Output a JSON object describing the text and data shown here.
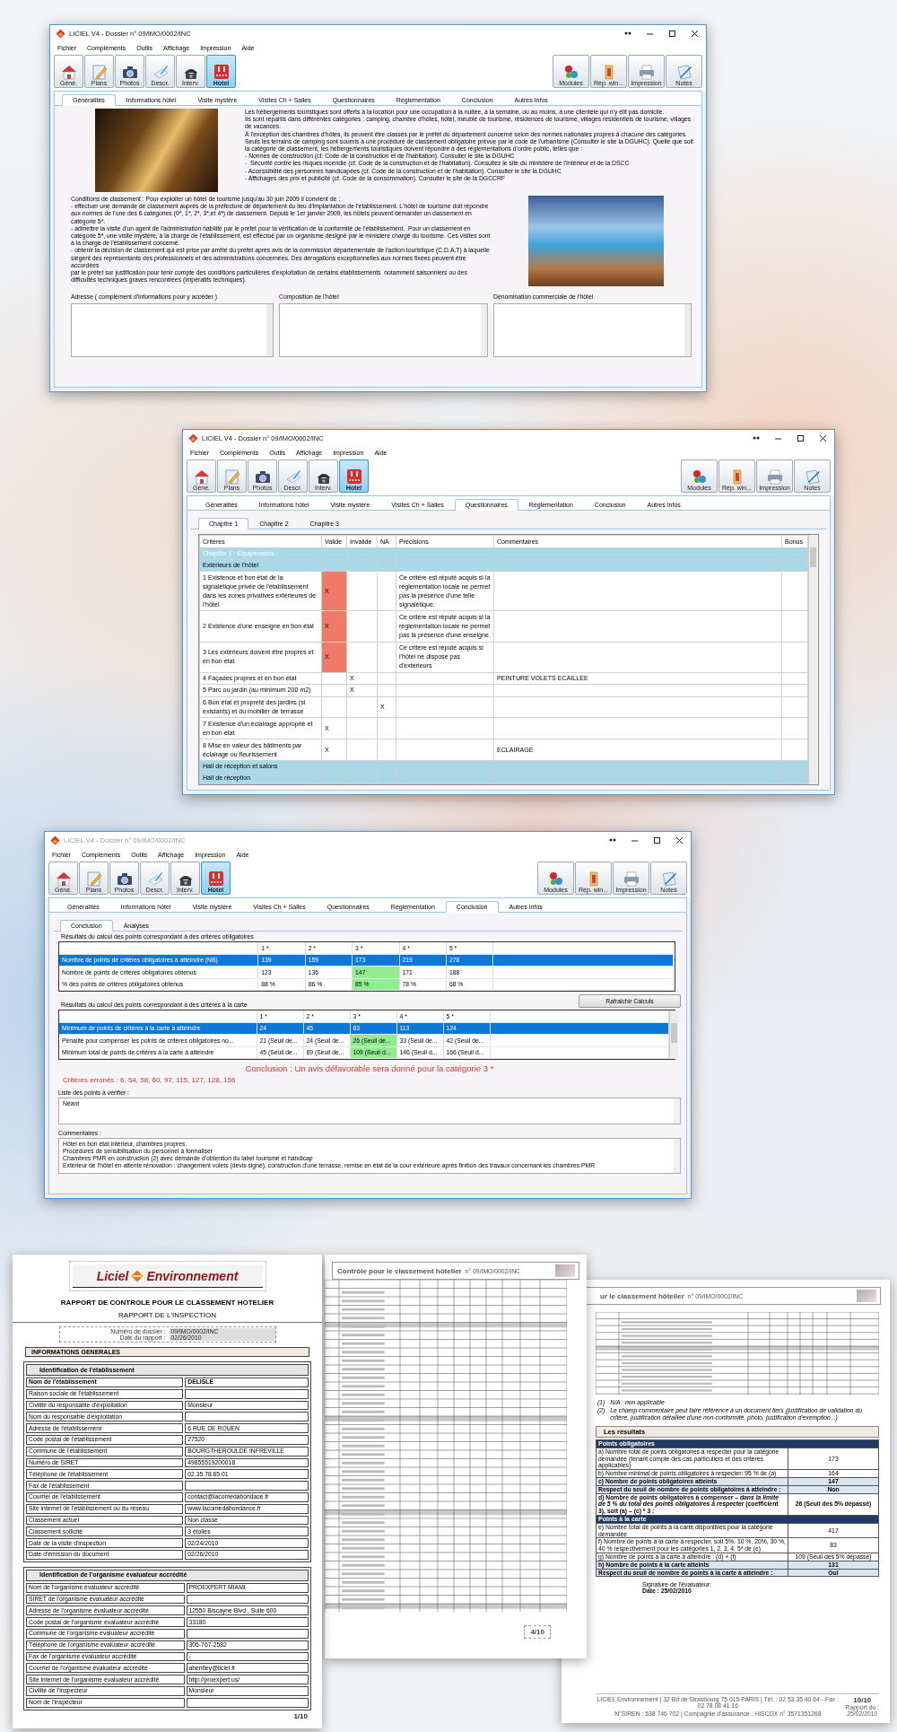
{
  "windows": [
    {
      "title": "LICIEL V4 - Dossier n° 09/IMO/0002/INC",
      "active": true,
      "menu": [
        "Fichier",
        "Compléments",
        "Outils",
        "Affichage",
        "Impression",
        "Aide"
      ],
      "toolbar_left": [
        {
          "label": "Géné.",
          "selected": false
        },
        {
          "label": "Plans",
          "selected": false
        },
        {
          "label": "Photos",
          "selected": false
        },
        {
          "label": "Descr.",
          "selected": false
        },
        {
          "label": "Interv.",
          "selected": false
        },
        {
          "label": "Hotel",
          "selected": true
        }
      ],
      "toolbar_right": [
        "Modules",
        "Rép. win...",
        "Impression",
        "Notes"
      ],
      "tabs": [
        {
          "label": "Généralités",
          "selected": true
        },
        {
          "label": "Informations hôtel",
          "selected": false
        },
        {
          "label": "Visite mystère",
          "selected": false
        },
        {
          "label": "Visites Ch + Salles",
          "selected": false
        },
        {
          "label": "Questionnaires",
          "selected": false
        },
        {
          "label": "Réglementation",
          "selected": false
        },
        {
          "label": "Conclusion",
          "selected": false
        },
        {
          "label": "Autres Infos",
          "selected": false
        }
      ],
      "content": {
        "kind": "generalites",
        "intro": "Les hébergements touristiques sont offerts à la location pour une occupation à la nuitée, à la semaine, ou au moins, à une clientèle qui n'y élit pas domicile.\nIls sont répartis dans différentes catégories : camping, chambre d'hôtes, hôtel, meublé de tourisme, résidences de tourisme, villages résidentiels de tourisme, villages de vacances.\nÀ l'exception des chambres d'hôtes, ils peuvent être classés par le préfet du département concerné selon des normes nationales propres à chacune des catégories. Seuls les terrains de camping sont soumis à une procédure de classement obligatoire prévue par le code de l'urbanisme (Consulter le site la DGUHC). Quelle que soit la catégorie de classement, les hébergements touristiques doivent répondre à des réglementations d'ordre public, telles que :\n- Normes de construction (cf. Code de la construction et de l'habitation). Consulter le site la DGUHC\n-  Sécurité contre les risques incendie (cf. Code de la construction et de l'habitation). Consultez le site du ministère de l'Intérieur et de la DSCC\n- Accessibilité des personnes handicapées (cf. Code de la construction et de l'habitation). Consulter le site la DGUHC\n- Affichages des prix et publicité (cf. Code de la consommation). Consulter le site de la DGCCRF",
        "conditions": "Conditions de classement : Pour exploiter un hôtel de tourisme jusqu'au 30 juin 2009 il convient de :\n- effectuer une demande de classement auprès de la préfecture de département du lieu d'implantation de l'établissement. L'hôtel de tourisme doit répondre aux normes de l'une des 6 catégories (0*, 1*, 2*, 3*,et 4*) de classement. Depuis le 1er janvier 2009, les hôtels peuvent demander un classement en catégorie 5*.\n- admettre la visite d'un agent de l'administration habilité par le préfet pour la vérification de la conformité de l'établissement.  Pour un classement en catégorie 5*, une visite mystère, à la charge de l'établissement, est effectué par un organisme désigné par le ministère chargé du tourisme. Ces visites sont à la charge de l'établissement concerné.\n- obtenir la décision de classement qui est prise par arrêté du préfet après avis de la commission départementale de l'action touristique (C.D.A.T) à laquelle siègent des représentants des professionnels et des administrations concernées. Des dérogations exceptionnelles aux normes fixées peuvent être accordées\npar le préfet sur justification pour tenir compte des conditions particulières d'exploitation de certains établissements  notamment saisonniers ou des difficultés techniques graves rencontrées (impératifs techniques).",
        "fields": [
          {
            "label": "Adresse ( complément d'informations pour y accéder )"
          },
          {
            "label": "Composition de l'hôtel"
          },
          {
            "label": "Dénomination commerciale de l'hôtel"
          }
        ]
      }
    },
    {
      "title": "LICIEL V4 - Dossier n° 09/IMO/0002/INC",
      "active": true,
      "menu": [
        "Fichier",
        "Compléments",
        "Outils",
        "Affichage",
        "Impression",
        "Aide"
      ],
      "toolbar_left": [
        {
          "label": "Géné.",
          "selected": false
        },
        {
          "label": "Plans",
          "selected": false
        },
        {
          "label": "Photos",
          "selected": false
        },
        {
          "label": "Descr.",
          "selected": false
        },
        {
          "label": "Interv.",
          "selected": false
        },
        {
          "label": "Hotel",
          "selected": true
        }
      ],
      "toolbar_right": [
        "Modules",
        "Rép. win...",
        "Impression",
        "Notes"
      ],
      "tabs": [
        {
          "label": "Généralités",
          "selected": false
        },
        {
          "label": "Informations hôtel",
          "selected": false
        },
        {
          "label": "Visite mystère",
          "selected": false
        },
        {
          "label": "Visites Ch + Salles",
          "selected": false
        },
        {
          "label": "Questionnaires",
          "selected": true
        },
        {
          "label": "Réglementation",
          "selected": false
        },
        {
          "label": "Conclusion",
          "selected": false
        },
        {
          "label": "Autres Infos",
          "selected": false
        }
      ],
      "content": {
        "kind": "questionnaires",
        "subtabs": [
          {
            "label": "Chapitre 1",
            "selected": true
          },
          {
            "label": "Chapitre 2",
            "selected": false
          },
          {
            "label": "Chapitre 3",
            "selected": false
          }
        ],
        "columns": [
          "Critères",
          "Valide",
          "Invalide",
          "NA",
          "Précisions",
          "Commentaires",
          "Bonus"
        ],
        "rows": [
          {
            "kind": "chapter",
            "label": "Chapitre 1 : Equipements",
            "selected": true
          },
          {
            "kind": "section",
            "label": "Extérieurs de l'hôtel",
            "selected": false
          },
          {
            "kind": "item",
            "selected": false,
            "flagged": true,
            "criterion": "1 Existence et bon état de la signalétique privée de l'établissement dans les zones privatives extérieures de l'hôtel",
            "valide": "X",
            "precisions": "Ce critère est réputé acquis si la réglementation locale ne permet pas la présence d'une telle signalétique."
          },
          {
            "kind": "item",
            "selected": false,
            "flagged": true,
            "criterion": "2 Existence d'une enseigne en bon état",
            "valide": "X",
            "precisions": "Ce critère est réputé acquis si la réglementation locale ne permet pas la présence d'une enseigne."
          },
          {
            "kind": "item",
            "selected": false,
            "flagged": true,
            "criterion": "3 Les extérieurs doivent être propres et en bon état",
            "valide": "X",
            "precisions": "Ce critère est réputé acquis si l'hôtel ne dispose pas d'extérieurs"
          },
          {
            "kind": "item",
            "selected": false,
            "flagged": false,
            "criterion": "4 Façades propres et en bon état",
            "invalide": "X",
            "commentaires": "PEINTURE VOLETS ECAILLEE"
          },
          {
            "kind": "item",
            "selected": false,
            "flagged": false,
            "criterion": "5 Parc ou jardin (au minimum 200 m2)",
            "invalide": "X"
          },
          {
            "kind": "item",
            "selected": false,
            "flagged": false,
            "criterion": "6 Bon état et propreté des jardins (si existants) et du mobilier de terrasse",
            "na": "X"
          },
          {
            "kind": "item",
            "selected": false,
            "flagged": false,
            "criterion": "7 Existence d'un éclairage approprié et en bon état",
            "valide": "X"
          },
          {
            "kind": "item",
            "selected": false,
            "flagged": false,
            "criterion": "8 Mise en valeur des bâtiments par éclairage ou fleurissement",
            "valide": "X",
            "commentaires": "ECLAIRAGE"
          },
          {
            "kind": "section",
            "label": "Hall de réception et salons",
            "selected": false
          },
          {
            "kind": "section",
            "label": "Hall de réception",
            "selected": false
          }
        ]
      }
    },
    {
      "title": "LICIEL V4 - Dossier n° 09/IMO/0002/INC",
      "active": false,
      "menu": [
        "Fichier",
        "Compléments",
        "Outils",
        "Affichage",
        "Impression",
        "Aide"
      ],
      "toolbar_left": [
        {
          "label": "Géné.",
          "selected": false
        },
        {
          "label": "Plans",
          "selected": false
        },
        {
          "label": "Photos",
          "selected": false
        },
        {
          "label": "Descr.",
          "selected": false
        },
        {
          "label": "Interv.",
          "selected": false
        },
        {
          "label": "Hotel",
          "selected": true
        }
      ],
      "toolbar_right": [
        "Modules",
        "Rép. win...",
        "Impression",
        "Notes"
      ],
      "tabs": [
        {
          "label": "Généralités",
          "selected": false
        },
        {
          "label": "Informations hôtel",
          "selected": false
        },
        {
          "label": "Visite mystère",
          "selected": false
        },
        {
          "label": "Visites Ch + Salles",
          "selected": false
        },
        {
          "label": "Questionnaires",
          "selected": false
        },
        {
          "label": "Réglementation",
          "selected": false
        },
        {
          "label": "Conclusion",
          "selected": true
        },
        {
          "label": "Autres Infos",
          "selected": false
        }
      ],
      "content": {
        "kind": "conclusion",
        "subtabs": [
          {
            "label": "Conclusion",
            "selected": true
          },
          {
            "label": "Analyses",
            "selected": false
          }
        ],
        "tables": [
          {
            "caption": "Résultats du calcul des points correspondant à des critères obligatoires",
            "columns": [
              {
                "label": "1 *",
                "highlighted": false
              },
              {
                "label": "2 *",
                "highlighted": false
              },
              {
                "label": "3 *",
                "highlighted": true
              },
              {
                "label": "4 *",
                "highlighted": false
              },
              {
                "label": "5 *",
                "highlighted": false
              }
            ],
            "rows": [
              {
                "label": "Nombre de points de critères obligatoires à atteindre (NB)",
                "values": [
                  "139",
                  "159",
                  "173",
                  "219",
                  "278"
                ],
                "selected": true
              },
              {
                "label": "Nombre de points de critères obligatoires obtenus",
                "values": [
                  "123",
                  "136",
                  "147",
                  "171",
                  "188"
                ],
                "selected": false
              },
              {
                "label": "% des points de critères obligatoires obtenus",
                "values": [
                  "88 %",
                  "86 %",
                  "85 %",
                  "78 %",
                  "68 %"
                ],
                "selected": false
              }
            ]
          },
          {
            "caption": "Résultats du calcul des points correspondant à des critères à la carte",
            "button": "Rafraichir Calculs",
            "columns": [
              {
                "label": "1 *",
                "highlighted": false
              },
              {
                "label": "2 *",
                "highlighted": false
              },
              {
                "label": "3 *",
                "highlighted": true
              },
              {
                "label": "4 *",
                "highlighted": false
              },
              {
                "label": "5 *",
                "highlighted": false
              }
            ],
            "rows": [
              {
                "label": "Minimum de points de critères à la carte à atteindre",
                "values": [
                  "24",
                  "45",
                  "83",
                  "113",
                  "124"
                ],
                "selected": true
              },
              {
                "label": "Pénalité pour compenser les points de critères obligatoires no...",
                "values": [
                  "21 (Seuil de...",
                  "24 (Seuil de...",
                  "26 (Seuil de...",
                  "33 (Seuil de...",
                  "42 (Seuil de..."
                ],
                "selected": false
              },
              {
                "label": "Minimum total de points de critères à la carte à atteindre",
                "values": [
                  "45 (Seuil de...",
                  "69 (Seuil de...",
                  "109 (Seuil d...",
                  "146 (Seuil d...",
                  "166 (Seuil d..."
                ],
                "selected": false
              }
            ]
          }
        ],
        "conclusion": "Conclusion : Un avis défavorable sera donné pour la catégorie 3 *",
        "errors": "Critères erronés : 6, 54, 58, 60, 97, 115, 127, 128, 156",
        "check_list": {
          "label": "Liste des points à vérifier :",
          "value": "Néant"
        },
        "comments": {
          "label": "Commentaires :",
          "value": "Hôtel en bon état intérieur, chambres propres.\nProcédures de sensibilisation du personnel à formaliser\nChambres PMR en construction (2) avec demande d'obtention du label tourisme et handicap\nExtérieur de l'hôtel en attente rénovation : changement volets (devis signé), construction d'une terrasse, remise en état de la cour extérieure après finition des travaux concernant les chambres PMR"
        }
      }
    }
  ],
  "documents": [
    {
      "kind": "identification",
      "logo": {
        "left": "Liciel",
        "right": "Environnement"
      },
      "title": "RAPPORT DE CONTROLE POUR LE CLASSEMENT HOTELIER",
      "subtitle": "RAPPORT DE L'INSPECTION",
      "meta": [
        {
          "label": "Numéro de dossier :",
          "value": "09/IMO/0002/INC"
        },
        {
          "label": "Date du rapport :",
          "value": "02/26/2010"
        }
      ],
      "section": "INFORMATIONS GENERALES",
      "tables": [
        {
          "caption": "Identification de l'établissement",
          "rows": [
            {
              "label": "Nom de l'établissement",
              "value": "DELISLE"
            },
            {
              "label": "Raison sociale de l'établissement"
            },
            {
              "label": "Civilité du responsable d'exploitation",
              "value": "Monsieur"
            },
            {
              "label": "Nom du responsable d'exploitation"
            },
            {
              "label": "Adresse de l'établissement",
              "value": "6 RUE DE ROUEN"
            },
            {
              "label": "Code postal de l'établissement",
              "value": "27520"
            },
            {
              "label": "Commune de l'établissement",
              "value": "BOURGTHEROULDE INFREVILLE"
            },
            {
              "label": "Numéro de SIRET",
              "value": "49855519200018"
            },
            {
              "label": "Téléphone de l'établissement",
              "value": "02.35.78.65.01"
            },
            {
              "label": "Fax de l'établissement"
            },
            {
              "label": "Courriel de l'établissement",
              "value": "contact@lacomedabondace.fr"
            },
            {
              "label": "Site internet de l'établissement ou du réseau",
              "value": "www.lacomedabondance.fr"
            },
            {
              "label": "Classement actuel",
              "value": "Non classé"
            },
            {
              "label": "Classement sollicité",
              "value": "3 étoiles"
            },
            {
              "label": "Date de la visite d'inspection",
              "value": "02/24/2010"
            },
            {
              "label": "Date d'émission du document",
              "value": "02/26/2010"
            }
          ]
        },
        {
          "caption": "Identification de l'organisme évaluateur accrédité",
          "rows": [
            {
              "label": "Nom de l'organisme évaluateur accrédité",
              "value": "PROEXPERT MIAMI"
            },
            {
              "label": "SIRET de l'organisme évaluateur accrédité"
            },
            {
              "label": "Adresse de l'organisme évaluateur accrédité",
              "value": "12550 Biscayne Blvd , Suite 600"
            },
            {
              "label": "Code postal de l'organisme évaluateur accrédité",
              "value": "33180"
            },
            {
              "label": "Commune de l'organisme évaluateur accrédité"
            },
            {
              "label": "Téléphone de l'organisme évaluateur accrédité",
              "value": "305-767-2582"
            },
            {
              "label": "Fax de l'organisme évaluateur accrédité",
              "value": "-"
            },
            {
              "label": "Courriel de l'organisme évaluateur accrédité",
              "value": "abentley@liciel.fr"
            },
            {
              "label": "Site internet de l'organisme évaluateur accrédité",
              "value": "http://proexpert.us/"
            },
            {
              "label": "Civilité de l'inspecteur",
              "value": "Monsieur"
            },
            {
              "label": "Nom de l'inspecteur"
            }
          ]
        }
      ],
      "page": "1/10"
    },
    {
      "kind": "criteria_grid",
      "title": "Contrôle pour le classement hôtelier",
      "reference": "n° 09/IMO/0002/INC",
      "page": "4/10"
    },
    {
      "kind": "results",
      "title": "ur le classement hôtelier",
      "reference": "n° 09/IMO/0002/INC",
      "notes": [
        {
          "mark": "(1)",
          "text": "N/A : non applicable"
        },
        {
          "mark": "(2)",
          "text": "Le champ commentaire peut faire référence à un document tiers (justification de validation du critère, justification détaillée d'une non-conformité, photo, justification d'exemption...)"
        }
      ],
      "results_title": "Les résultats",
      "results": [
        {
          "kind": "header",
          "label": "Points obligatoires"
        },
        {
          "kind": "row",
          "label": "a) Nombre total de points obligatoires à respecter pour la catégorie demandée (tenant compte des cas particuliers et des critères applicables)",
          "value": "173"
        },
        {
          "kind": "row",
          "label": "b) Nombre minimal de points obligatoires à respecter: 95 % de (a)",
          "value": "164"
        },
        {
          "kind": "emphasis",
          "label": "c) Nombre de points obligatoires atteints",
          "value": "147"
        },
        {
          "kind": "emphasis",
          "label": "Respect du seuil de nombre de points obligatoires à atteindre :",
          "value": "Non"
        },
        {
          "kind": "strong",
          "label": "d) Nombre de points obligatoires à compenser – *dans la limite de 5 % du total des points obligatoires à respecter* (coefficient 3), soit (a) – (c) * 3 :",
          "value": "26 (Seuil des 5% dépassé)"
        },
        {
          "kind": "header",
          "label": "Points à la carte"
        },
        {
          "kind": "row",
          "label": "e) Nombre total de points à la carte disponibles pour la catégorie demandée",
          "value": "417"
        },
        {
          "kind": "row",
          "label": "f) Nombre de points à la carte à respecter, soit 5%, 10 %, 20%, 30 %, 40 % respectivement pour les catégories 1, 2, 3, 4, 5* de (e)",
          "value": "83"
        },
        {
          "kind": "row",
          "label": "g) Nombre de points à la carte à atteindre : (d) + (f)",
          "value": "109 (Seuil des 5% dépassé)"
        },
        {
          "kind": "emphasis",
          "label": "h) Nombre de points à la carte atteints",
          "value": "131"
        },
        {
          "kind": "emphasis",
          "label": "Respect du seuil de nombre de points à la carte à atteindre :",
          "value": "Oui"
        }
      ],
      "signature": "Signature de l'évaluateur:",
      "date": "Date : 25/02/2010",
      "footer": [
        "LICIEL Environnement | 32 Bd de Strasbourg 75 015 PARIS | Tél. : 02 53 35 40 64 - Fax : 02 78 08 41 16",
        "N°SIREN : 538 746 702 | Compagnie d'assurance : HISCOX n° 3571351268"
      ],
      "page": "10/10",
      "page_caption": "Rapport du :",
      "page_date": "25/02/2010"
    }
  ]
}
